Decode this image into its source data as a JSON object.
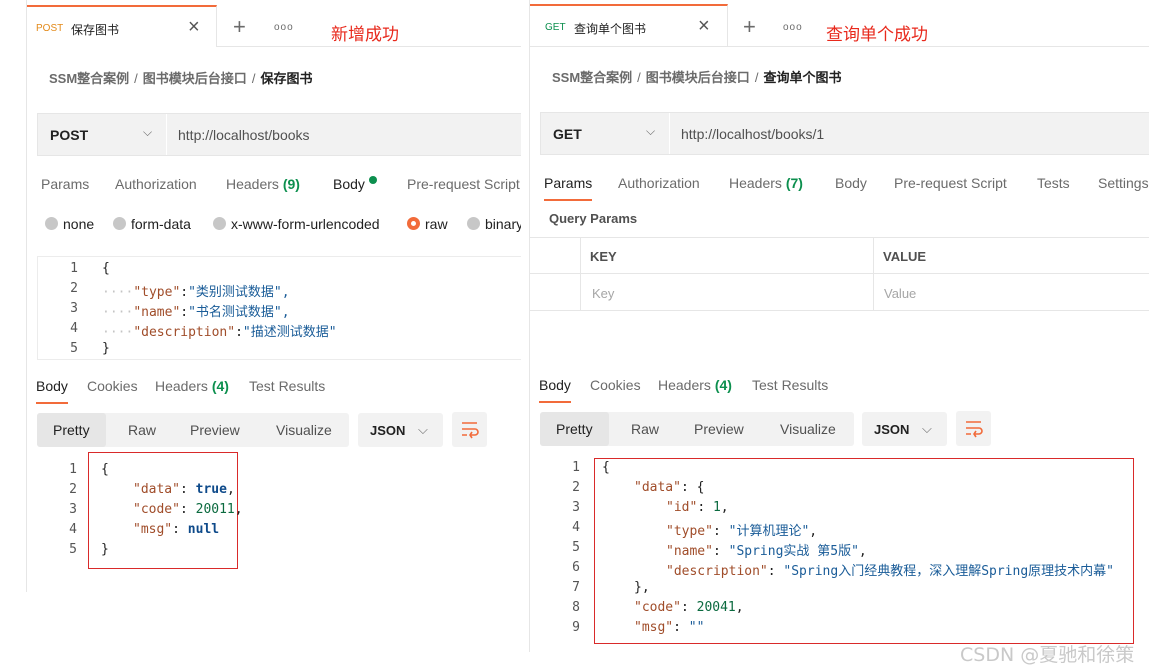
{
  "left": {
    "tab": {
      "method": "POST",
      "name": "保存图书"
    },
    "annotation": "新增成功",
    "breadcrumb": [
      "SSM整合案例",
      "图书模块后台接口",
      "保存图书"
    ],
    "url_bar": {
      "method": "POST",
      "url": "http://localhost/books"
    },
    "request_tabs": {
      "params": "Params",
      "authorization": "Authorization",
      "headers": "Headers",
      "headers_count": "(9)",
      "body": "Body",
      "prerequest": "Pre-request Script"
    },
    "body_types": [
      "none",
      "form-data",
      "x-www-form-urlencoded",
      "raw",
      "binary"
    ],
    "request_body": {
      "line_numbers": [
        "1",
        "2",
        "3",
        "4",
        "5"
      ],
      "open": "{",
      "close": "}",
      "fields": [
        {
          "key": "\"type\"",
          "value": "\"类别测试数据\","
        },
        {
          "key": "\"name\"",
          "value": "\"书名测试数据\","
        },
        {
          "key": "\"description\"",
          "value": "\"描述测试数据\""
        }
      ]
    },
    "response_tabs": {
      "body": "Body",
      "cookies": "Cookies",
      "headers": "Headers",
      "headers_count": "(4)",
      "test_results": "Test Results"
    },
    "view_modes": [
      "Pretty",
      "Raw",
      "Preview",
      "Visualize"
    ],
    "format": "JSON",
    "response_body": {
      "line_numbers": [
        "1",
        "2",
        "3",
        "4",
        "5"
      ],
      "open": "{",
      "close": "}",
      "data_key": "\"data\"",
      "data_value": "true",
      "code_key": "\"code\"",
      "code_value": "20011",
      "msg_key": "\"msg\"",
      "msg_value": "null"
    }
  },
  "right": {
    "tab": {
      "method": "GET",
      "name": "查询单个图书"
    },
    "annotation": "查询单个成功",
    "breadcrumb": [
      "SSM整合案例",
      "图书模块后台接口",
      "查询单个图书"
    ],
    "url_bar": {
      "method": "GET",
      "url": "http://localhost/books/1"
    },
    "request_tabs": {
      "params": "Params",
      "authorization": "Authorization",
      "headers": "Headers",
      "headers_count": "(7)",
      "body": "Body",
      "prerequest": "Pre-request Script",
      "tests": "Tests",
      "settings": "Settings"
    },
    "query_params": {
      "title": "Query Params",
      "key_header": "KEY",
      "value_header": "VALUE",
      "key_placeholder": "Key",
      "value_placeholder": "Value"
    },
    "response_tabs": {
      "body": "Body",
      "cookies": "Cookies",
      "headers": "Headers",
      "headers_count": "(4)",
      "test_results": "Test Results"
    },
    "view_modes": [
      "Pretty",
      "Raw",
      "Preview",
      "Visualize"
    ],
    "format": "JSON",
    "response_body": {
      "line_numbers": [
        "1",
        "2",
        "3",
        "4",
        "5",
        "6",
        "7",
        "8",
        "9"
      ],
      "open": "{",
      "data_key": "\"data\"",
      "id_key": "\"id\"",
      "id_value": "1",
      "type_key": "\"type\"",
      "type_value": "\"计算机理论\"",
      "name_key": "\"name\"",
      "name_value": "\"Spring实战 第5版\"",
      "description_key": "\"description\"",
      "description_value": "\"Spring入门经典教程，深入理解Spring原理技术内幕\"",
      "close_data": "},",
      "code_key": "\"code\"",
      "code_value": "20041",
      "msg_key": "\"msg\"",
      "msg_value": "\"\""
    }
  },
  "watermark": "CSDN @夏驰和徐策",
  "colors": {
    "accent": "#f26b3a",
    "green": "#0c8f4e",
    "annotation_red": "#e8291c",
    "box_red": "#d92a2a"
  },
  "icons": [
    "close-icon",
    "plus-icon",
    "more-icon",
    "chevron-down-icon",
    "wrap-lines-icon"
  ]
}
